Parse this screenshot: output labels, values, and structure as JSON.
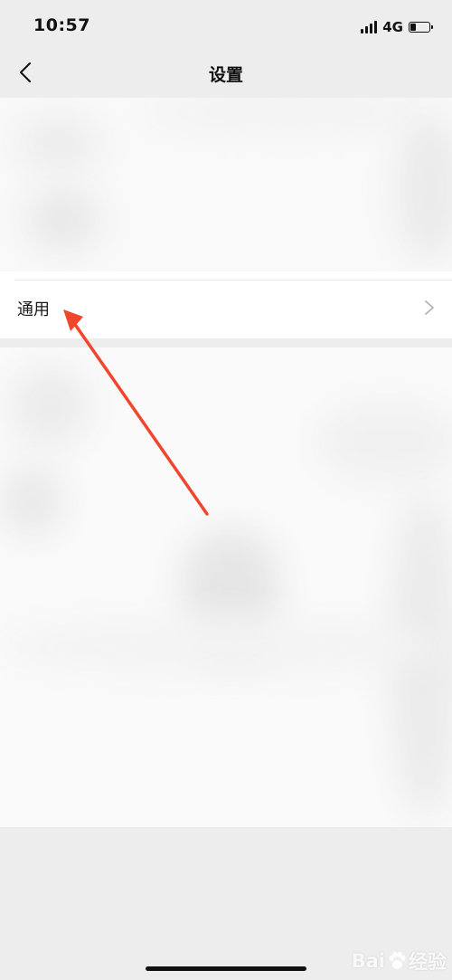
{
  "status_bar": {
    "time": "10:57",
    "network": "4G",
    "battery_level": 0.3
  },
  "nav": {
    "title": "设置",
    "back_icon": "chevron-left-icon"
  },
  "settings": {
    "general_label": "通用",
    "general_chevron": "chevron-right-icon"
  },
  "annotation": {
    "arrow_color": "#f0462d"
  },
  "watermark": {
    "text_left": "Bai",
    "text_right": "经验"
  }
}
